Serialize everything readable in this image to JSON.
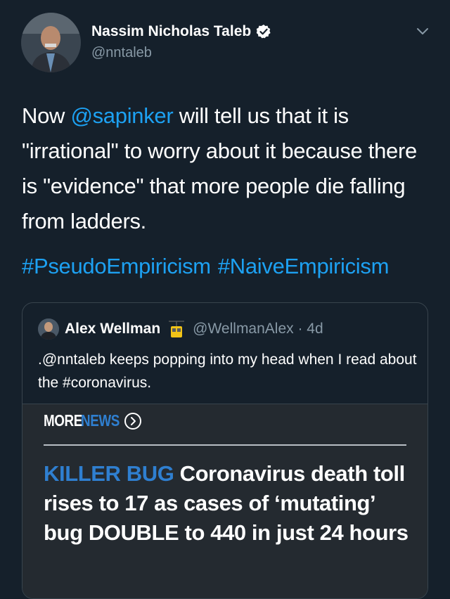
{
  "author": {
    "name": "Nassim Nicholas Taleb",
    "handle": "@nntaleb",
    "icons": {
      "verified": "verified-badge-icon",
      "menu": "chevron-down-icon"
    }
  },
  "tweet": {
    "text_before": "Now ",
    "mention": "@sapinker",
    "text_after": " will tell us that it is \"irrational\" to worry about it because there is \"evidence\" that more people die falling from ladders.",
    "hashtags": [
      "#PseudoEmpiricism",
      "#NaiveEmpiricism"
    ]
  },
  "quoted": {
    "name": "Alex Wellman",
    "emoji_icon": "aerial-tramway-icon",
    "handle_time": "@WellmanAlex · 4d",
    "text": ".@nntaleb keeps popping into my head when I read about the #coronavirus.",
    "media": {
      "more_label": "MORE",
      "news_label": "NEWS",
      "kicker": "KILLER BUG",
      "headline": " Coronavirus death toll rises to 17 as cases of ‘mutating’ bug DOUBLE to 440 in just 24 hours"
    }
  },
  "colors": {
    "background": "#15202b",
    "accent": "#1da1f2",
    "muted": "#8899a6",
    "news_blue": "#2f7fd0"
  }
}
